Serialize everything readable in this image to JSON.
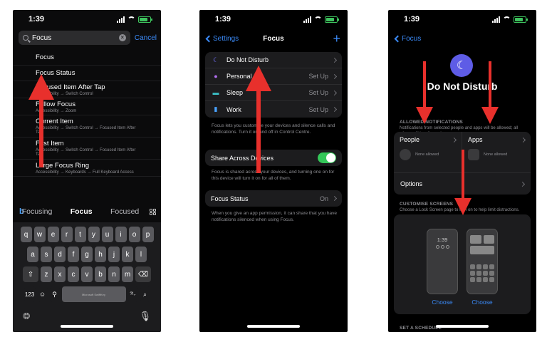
{
  "common": {
    "time": "1:39",
    "accent": "#3b8af7",
    "arrow_color": "#e8302c"
  },
  "phone1": {
    "search": {
      "value": "Focus",
      "cancel": "Cancel"
    },
    "results": [
      {
        "title": "Focus",
        "subtitle": ""
      },
      {
        "title": "Focus Status",
        "subtitle": ""
      },
      {
        "title": "Focused Item After Tap",
        "subtitle": "Accessibility → Switch Control"
      },
      {
        "title": "Follow Focus",
        "subtitle": "Accessibility → Zoom"
      },
      {
        "title": "Current Item",
        "subtitle": "Accessibility → Switch Control → Focused Item After Tap"
      },
      {
        "title": "First Item",
        "subtitle": "Accessibility → Switch Control → Focused Item After Tap"
      },
      {
        "title": "Large Focus Ring",
        "subtitle": "Accessibility → Keyboards → Full Keyboard Access"
      }
    ],
    "suggestions": [
      "Focusing",
      "Focus",
      "Focused"
    ],
    "keys": {
      "row1": [
        "q",
        "w",
        "e",
        "r",
        "t",
        "y",
        "u",
        "i",
        "o",
        "p"
      ],
      "row2": [
        "a",
        "s",
        "d",
        "f",
        "g",
        "h",
        "j",
        "k",
        "l"
      ],
      "row3": [
        "z",
        "x",
        "c",
        "v",
        "b",
        "n",
        "m"
      ],
      "numbers": "123",
      "space": "Microsoft SwiftKey",
      "punct": "?!,."
    }
  },
  "phone2": {
    "back": "Settings",
    "title": "Focus",
    "modes": [
      {
        "label": "Do Not Disturb",
        "value": "",
        "icon": "☾",
        "color": "#6e6cf0"
      },
      {
        "label": "Personal",
        "value": "Set Up",
        "icon": "●",
        "color": "#b26ef0"
      },
      {
        "label": "Sleep",
        "value": "Set Up",
        "icon": "▬",
        "color": "#3bc3c9"
      },
      {
        "label": "Work",
        "value": "Set Up",
        "icon": "▮",
        "color": "#4aa3ff"
      }
    ],
    "modes_caption": "Focus lets you customise your devices and silence calls and notifications. Turn it on and off in Control Centre.",
    "share": {
      "label": "Share Across Devices",
      "on": true
    },
    "share_caption": "Focus is shared across your devices, and turning one on for this device will turn it on for all of them.",
    "status": {
      "label": "Focus Status",
      "value": "On"
    },
    "status_caption": "When you give an app permission, it can share that you have notifications silenced when using Focus."
  },
  "phone3": {
    "back": "Focus",
    "title": "Do Not Disturb",
    "allow_header": "ALLOWED NOTIFICATIONS",
    "allow_caption": "Notifications from selected people and apps will be allowed; all others will be silenced.",
    "people": {
      "label": "People",
      "sub": "None allowed"
    },
    "apps": {
      "label": "Apps",
      "sub": "None allowed"
    },
    "options": "Options",
    "screens_header": "CUSTOMISE SCREENS",
    "screens_caption": "Choose a Lock Screen page to turn on to help limit distractions.",
    "lock_time": "1:39",
    "choose1": "Choose",
    "choose2": "Choose",
    "schedule_header": "SET A SCHEDULE"
  }
}
